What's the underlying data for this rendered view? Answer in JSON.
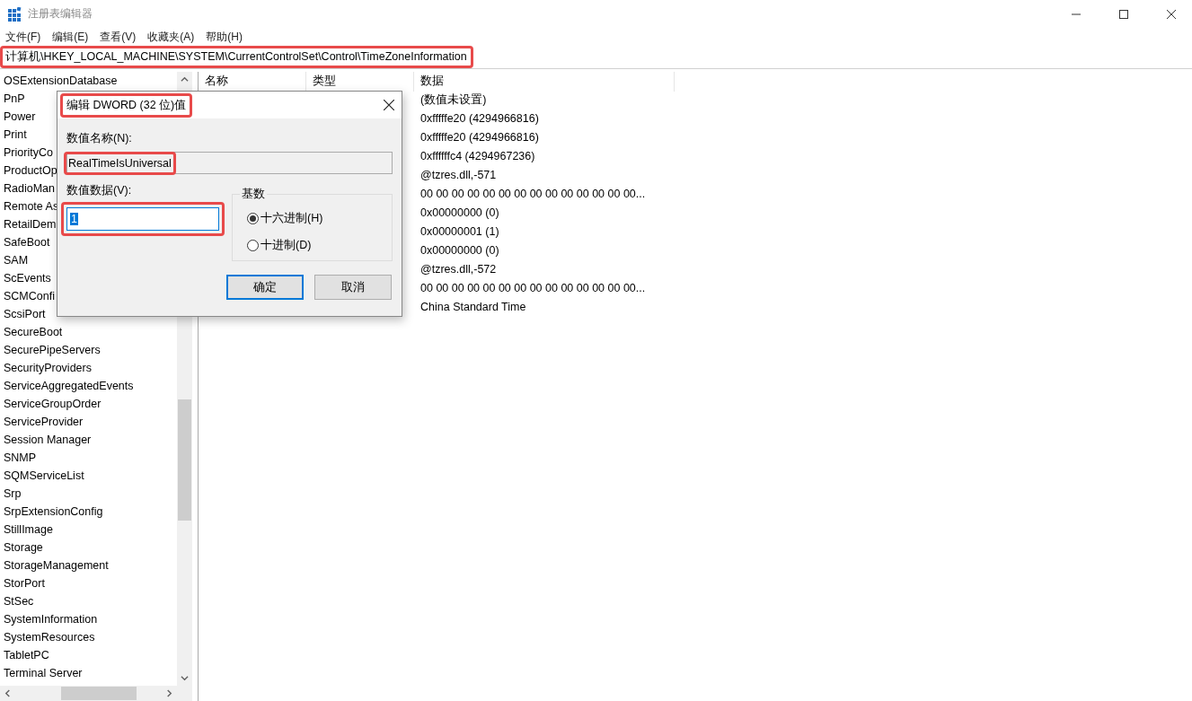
{
  "window": {
    "title": "注册表编辑器"
  },
  "menu": [
    "文件(F)",
    "编辑(E)",
    "查看(V)",
    "收藏夹(A)",
    "帮助(H)"
  ],
  "address": {
    "value": "计算机\\HKEY_LOCAL_MACHINE\\SYSTEM\\CurrentControlSet\\Control\\TimeZoneInformation",
    "highlighted": true
  },
  "tree": {
    "items": [
      "OSExtensionDatabase",
      "PnP",
      "Power",
      "Print",
      "PriorityCo",
      "ProductOp",
      "RadioMan",
      "Remote As",
      "RetailDem",
      "SafeBoot",
      "SAM",
      "ScEvents",
      "SCMConfi",
      "ScsiPort",
      "SecureBoot",
      "SecurePipeServers",
      "SecurityProviders",
      "ServiceAggregatedEvents",
      "ServiceGroupOrder",
      "ServiceProvider",
      "Session Manager",
      "SNMP",
      "SQMServiceList",
      "Srp",
      "SrpExtensionConfig",
      "StillImage",
      "Storage",
      "StorageManagement",
      "StorPort",
      "StSec",
      "SystemInformation",
      "SystemResources",
      "TabletPC",
      "Terminal Server"
    ]
  },
  "values": {
    "columns": [
      "名称",
      "类型",
      "数据"
    ],
    "data": [
      "(数值未设置)",
      "0xfffffe20 (4294966816)",
      "0xfffffe20 (4294966816)",
      "0xffffffc4 (4294967236)",
      "@tzres.dll,-571",
      "00 00 00 00 00 00 00 00 00 00 00 00 00 00...",
      "0x00000000 (0)",
      "0x00000001 (1)",
      "0x00000000 (0)",
      "@tzres.dll,-572",
      "00 00 00 00 00 00 00 00 00 00 00 00 00 00...",
      "China Standard Time"
    ]
  },
  "dialog": {
    "title": "编辑 DWORD (32 位)值",
    "title_highlighted": true,
    "name_label": "数值名称(N):",
    "name_value": "RealTimeIsUniversal",
    "name_highlighted": true,
    "data_label": "数值数据(V):",
    "data_value": "1",
    "data_highlighted": true,
    "base_label": "基数",
    "bases": [
      {
        "label": "十六进制(H)",
        "selected": true
      },
      {
        "label": "十进制(D)",
        "selected": false
      }
    ],
    "buttons": [
      "确定",
      "取消"
    ]
  }
}
